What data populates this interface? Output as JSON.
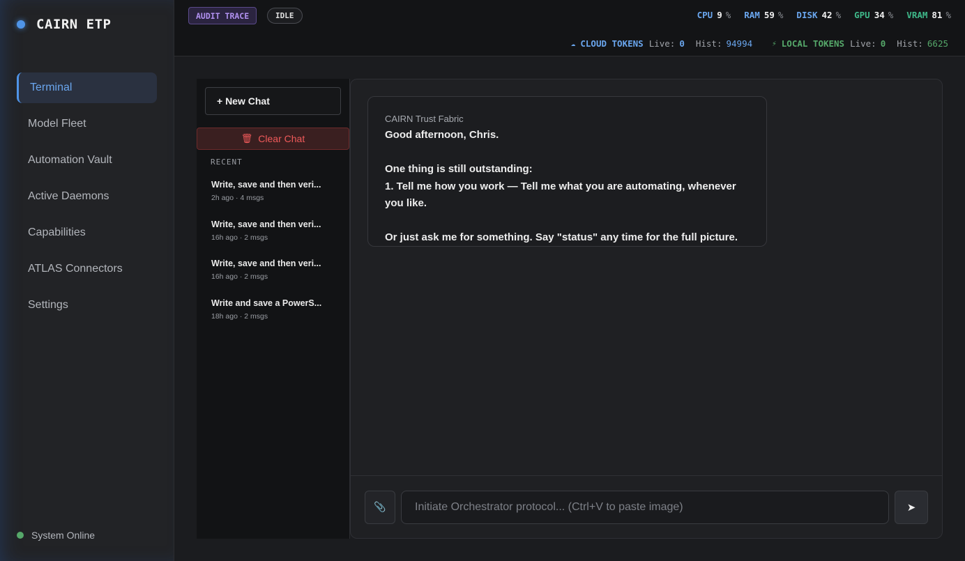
{
  "brand": {
    "name": "CAIRN ETP",
    "accent": "#4f94e8"
  },
  "sidebar": {
    "items": [
      {
        "label": "Terminal",
        "active": true
      },
      {
        "label": "Model Fleet"
      },
      {
        "label": "Automation Vault"
      },
      {
        "label": "Active Daemons"
      },
      {
        "label": "Capabilities"
      },
      {
        "label": "ATLAS Connectors"
      },
      {
        "label": "Settings"
      }
    ],
    "status": "System Online",
    "status_color": "#56a86a"
  },
  "header": {
    "audit_badge": "AUDIT TRACE",
    "state_badge": "IDLE",
    "metrics": [
      {
        "label": "CPU",
        "value": "9",
        "unit": "%",
        "color": "#6aa6ee"
      },
      {
        "label": "RAM",
        "value": "59",
        "unit": "%",
        "color": "#6aa6ee"
      },
      {
        "label": "DISK",
        "value": "42",
        "unit": "%",
        "color": "#6aa6ee"
      },
      {
        "label": "GPU",
        "value": "34",
        "unit": "%",
        "color": "#3fb98a"
      },
      {
        "label": "VRAM",
        "value": "81",
        "unit": "%",
        "color": "#3fb98a"
      }
    ],
    "tokens": {
      "cloud": {
        "label": "CLOUD TOKENS",
        "live_label": "Live:",
        "live": "0",
        "hist_label": "Hist:",
        "hist": "94994",
        "color": "#6aa6ee",
        "icon": "cloud-icon"
      },
      "local": {
        "label": "LOCAL TOKENS",
        "live_label": "Live:",
        "live": "0",
        "hist_label": "Hist:",
        "hist": "6625",
        "color": "#56a86a",
        "icon": "bolt-icon"
      }
    }
  },
  "chatlist": {
    "new_chat": "+ New Chat",
    "clear_chat": "Clear Chat",
    "recent_label": "RECENT",
    "items": [
      {
        "title": "Write, save and then veri...",
        "meta": "2h ago · 4 msgs"
      },
      {
        "title": "Write, save and then veri...",
        "meta": "16h ago · 2 msgs"
      },
      {
        "title": "Write, save and then veri...",
        "meta": "16h ago · 2 msgs"
      },
      {
        "title": "Write and save a PowerS...",
        "meta": "18h ago · 2 msgs"
      }
    ]
  },
  "conversation": {
    "sender": "CAIRN Trust Fabric",
    "greeting": "Good afternoon, Chris.",
    "line1": "One thing is still outstanding:",
    "line2": "1. Tell me how you work — Tell me what you are automating, whenever you like.",
    "line3": "Or just ask me for something. Say \"status\" any time for the full picture."
  },
  "composer": {
    "placeholder": "Initiate Orchestrator protocol... (Ctrl+V to paste image)",
    "value": "",
    "attach_icon": "paperclip-icon",
    "send_icon": "send-icon"
  }
}
